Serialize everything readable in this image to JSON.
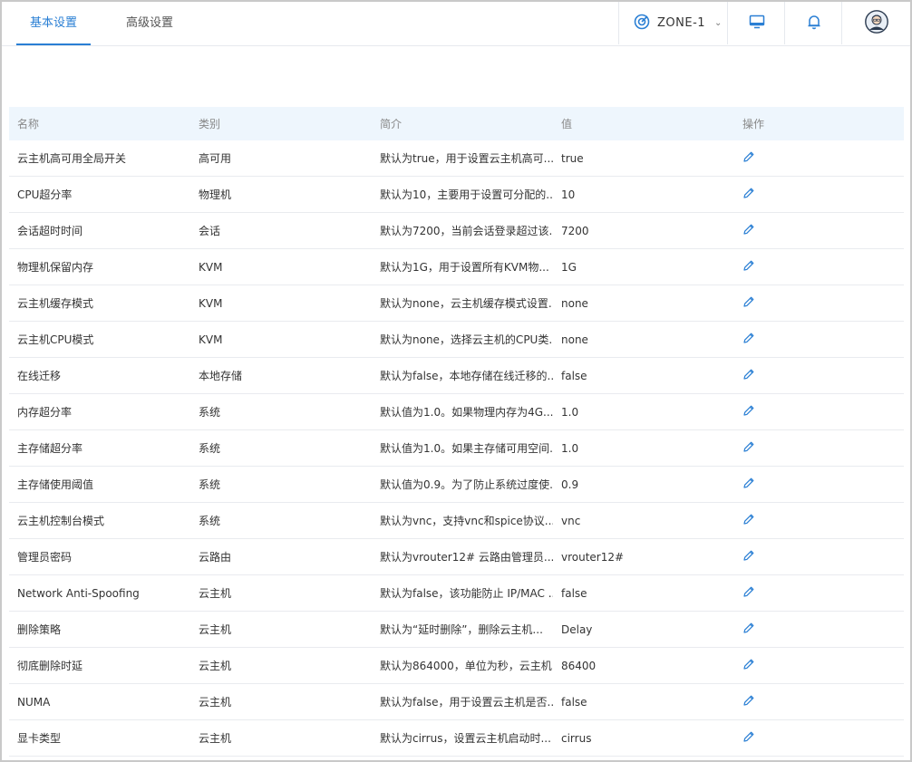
{
  "tabs": [
    {
      "label": "基本设置",
      "active": true
    },
    {
      "label": "高级设置",
      "active": false
    }
  ],
  "zone": {
    "label": "ZONE-1"
  },
  "colors": {
    "accent": "#2a7fd4",
    "header_bg": "#eef6fd",
    "border": "#e6e9ee"
  },
  "icons": {
    "zone": "zone-target-icon",
    "monitor": "monitor-icon",
    "bell": "bell-icon",
    "avatar": "user-avatar-icon",
    "edit": "pencil-icon"
  },
  "table": {
    "columns": [
      "名称",
      "类别",
      "简介",
      "值",
      "操作"
    ],
    "rows": [
      {
        "name": "云主机高可用全局开关",
        "category": "高可用",
        "desc": "默认为true，用于设置云主机高可...",
        "value": "true"
      },
      {
        "name": "CPU超分率",
        "category": "物理机",
        "desc": "默认为10，主要用于设置可分配的...",
        "value": "10"
      },
      {
        "name": "会话超时时间",
        "category": "会话",
        "desc": "默认为7200，当前会话登录超过该...",
        "value": "7200"
      },
      {
        "name": "物理机保留内存",
        "category": "KVM",
        "desc": "默认为1G，用于设置所有KVM物...",
        "value": "1G"
      },
      {
        "name": "云主机缓存模式",
        "category": "KVM",
        "desc": "默认为none，云主机缓存模式设置...",
        "value": "none"
      },
      {
        "name": "云主机CPU模式",
        "category": "KVM",
        "desc": "默认为none，选择云主机的CPU类...",
        "value": "none"
      },
      {
        "name": "在线迁移",
        "category": "本地存储",
        "desc": "默认为false，本地存储在线迁移的...",
        "value": "false"
      },
      {
        "name": "内存超分率",
        "category": "系统",
        "desc": "默认值为1.0。如果物理内存为4G...",
        "value": "1.0"
      },
      {
        "name": "主存储超分率",
        "category": "系统",
        "desc": "默认值为1.0。如果主存储可用空间...",
        "value": "1.0"
      },
      {
        "name": "主存储使用阈值",
        "category": "系统",
        "desc": "默认值为0.9。为了防止系统过度使...",
        "value": "0.9"
      },
      {
        "name": "云主机控制台模式",
        "category": "系统",
        "desc": "默认为vnc，支持vnc和spice协议...",
        "value": "vnc"
      },
      {
        "name": "管理员密码",
        "category": "云路由",
        "desc": "默认为vrouter12# 云路由管理员...",
        "value": "vrouter12#"
      },
      {
        "name": "Network Anti-Spoofing",
        "category": "云主机",
        "desc": "默认为false，该功能防止 IP/MAC ...",
        "value": "false"
      },
      {
        "name": "删除策略",
        "category": "云主机",
        "desc": "默认为“延时删除”，删除云主机...",
        "value": "Delay"
      },
      {
        "name": "彻底删除时延",
        "category": "云主机",
        "desc": "默认为864000，单位为秒，云主机...",
        "value": "86400"
      },
      {
        "name": "NUMA",
        "category": "云主机",
        "desc": "默认为false，用于设置云主机是否...",
        "value": "false"
      },
      {
        "name": "显卡类型",
        "category": "云主机",
        "desc": "默认为cirrus，设置云主机启动时...",
        "value": "cirrus"
      }
    ]
  }
}
